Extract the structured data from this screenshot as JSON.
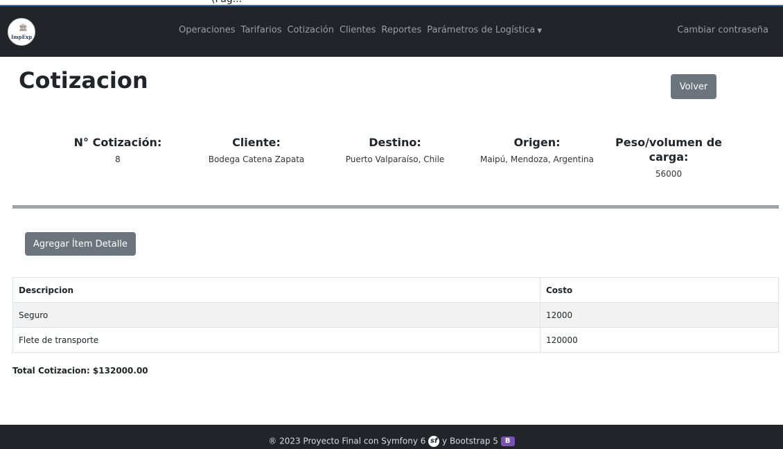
{
  "brand": {
    "logo_text": "ImpExp"
  },
  "nav": {
    "links": [
      "Operaciones",
      "Tarifarios",
      "Cotización",
      "Clientes",
      "Reportes",
      "Parámetros de Logística"
    ],
    "right": "Cambiar contraseña"
  },
  "page": {
    "title": "Cotizacion",
    "back_button": "Volver",
    "add_button": "Agregar Ítem Detalle"
  },
  "quote": {
    "fields": [
      {
        "label": "N° Cotización:",
        "value": "8"
      },
      {
        "label": "Cliente:",
        "value": "Bodega Catena Zapata"
      },
      {
        "label": "Destino:",
        "value": "Puerto Valparaíso, Chile"
      },
      {
        "label": "Origen:",
        "value": "Maipú, Mendoza, Argentina"
      },
      {
        "label": "Peso/volumen de carga:",
        "value": "56000"
      }
    ]
  },
  "table": {
    "headers": [
      "Descripcion",
      "Costo"
    ],
    "rows": [
      {
        "descripcion": "Seguro",
        "costo": "12000"
      },
      {
        "descripcion": "Flete de transporte",
        "costo": "120000"
      }
    ]
  },
  "total": "Total Cotizacion: $132000.00",
  "footer": {
    "prefix": "® 2023 Proyecto Final con Symfony 6",
    "middle": "y Bootstrap 5"
  },
  "colors": {
    "navbar": "#212529",
    "button": "#6c757d",
    "divider": "#9fa4a9",
    "bootstrap_brand": "#7952b3"
  }
}
